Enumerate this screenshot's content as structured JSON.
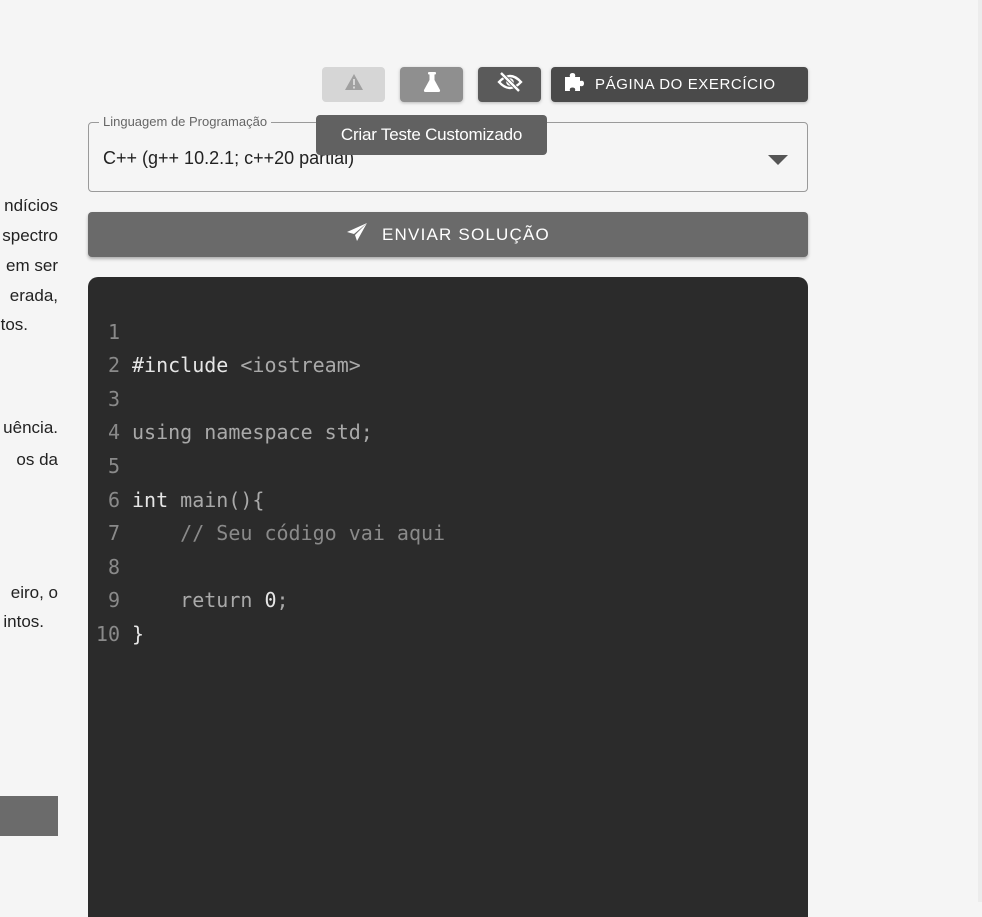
{
  "left_text": {
    "lines": [
      "ndícios",
      "spectro",
      "em ser",
      "erada,",
      "tos.",
      "uência.",
      "os da",
      "eiro, o",
      "intos."
    ]
  },
  "toolbar": {
    "warning_icon": "warning-triangle-icon",
    "test_icon": "flask-icon",
    "hide_icon": "eye-off-icon",
    "page_icon": "puzzle-icon",
    "page_label": "PÁGINA DO EXERCÍCIO"
  },
  "tooltip": {
    "text": "Criar Teste Customizado"
  },
  "language_select": {
    "label": "Linguagem de Programação",
    "value": "C++ (g++ 10.2.1; c++20 partial)"
  },
  "submit": {
    "label": "ENVIAR SOLUÇÃO",
    "icon": "send-icon"
  },
  "editor": {
    "line_numbers": [
      "1",
      "2",
      "3",
      "4",
      "5",
      "6",
      "7",
      "8",
      "9",
      "10"
    ],
    "lines": [
      "#include <iostream>",
      "",
      "using namespace std;",
      "",
      "int main(){",
      "    // Seu código vai aqui",
      "",
      "    return 0;",
      "}",
      ""
    ]
  },
  "colors": {
    "background": "#f5f5f5",
    "editor_bg": "#2b2b2b",
    "button_dark": "#4a4a4a",
    "submit_bg": "#6a6a6a"
  }
}
